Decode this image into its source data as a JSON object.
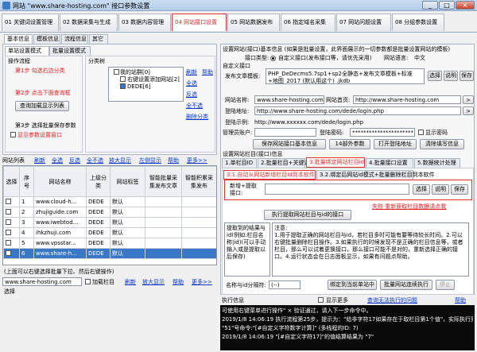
{
  "window": {
    "title": "网站 \"www.share-hosting.com\" 接口参数设置",
    "controls": [
      "_",
      "□",
      "×"
    ]
  },
  "maintabs": [
    "01 关键词设置管理",
    "02 数据采集与生成",
    "03 数据内容管理",
    "04 网站接口设置",
    "05 网站数据发布",
    "06 指定域名采集",
    "07 网站问题设置",
    "08 分组参数设置"
  ],
  "subtabs": [
    "基本信息",
    "模板信息",
    "流程信息",
    "其它"
  ],
  "left": {
    "mode_tabs": [
      "单站设置模式",
      "批量设置模式"
    ],
    "flow_title": "操作流程",
    "step1": "第1步 勾选右边分类",
    "step2": "第2步 点击下面查询框",
    "step2_btn": "查询加载显示列表",
    "step3": "第3步 选择批量保存参数",
    "show_params": "显示参数设置窗口",
    "cat_title": "分类树",
    "tree_root": "我的站群[0]",
    "tree_child1": "右键设置添加网站[2]",
    "tree_child2": "DEDE[6]",
    "cat_links": [
      "刷新",
      "帮助",
      "全选",
      "反选",
      "全不选",
      "删除分类"
    ]
  },
  "sitelist": {
    "label": "网站列表",
    "links": [
      "刷新",
      "全选",
      "反选",
      "全不选",
      "放大显示",
      "左侧显示",
      "帮助",
      "更多>>"
    ],
    "headers": [
      "选择",
      "序号",
      "网站名称",
      "上级分类",
      "网站标签",
      "智能批量采集发布文章",
      "智能积累采集发布"
    ],
    "rows": [
      {
        "no": "1",
        "name": "www.cloud-h...",
        "cat": "DEDE",
        "tag": "默认"
      },
      {
        "no": "2",
        "name": "zhujiguide.com",
        "cat": "DEDE",
        "tag": "默认"
      },
      {
        "no": "3",
        "name": "www.iwebtod...",
        "cat": "DEDE",
        "tag": "默认"
      },
      {
        "no": "4",
        "name": "ihkzhuji.com",
        "cat": "DEDE",
        "tag": "默认"
      },
      {
        "no": "5",
        "name": "www.vpsstar...",
        "cat": "DEDE",
        "tag": "默认"
      },
      {
        "no": "6",
        "name": "www.share-h...",
        "cat": "DEDE",
        "tag": "默认"
      }
    ],
    "hint": "(上面可以右键选择批量下拉、然后右键操作)",
    "current_site": "www.share-hosting.com",
    "add_category": "加载栏目",
    "foot_links": [
      "刷新",
      "放大显示",
      "帮助",
      "更多>>"
    ],
    "select_label": "选择"
  },
  "right": {
    "section_title": "设置网站(接口)基本信息 (如果是批量设置，此界面展示的一切参数都是批量设置网站的模板)",
    "iface_type_label": "接口类型:",
    "iface_custom": "自定义接口(发布接口等，请优先采用)",
    "site_lang_label": "网站语言:",
    "site_lang_value": "中文",
    "custom_iface_label": "自定义接口",
    "publish_tpl_label": "发布文章模板:",
    "publish_tpl_value": "PHP_DeDecms5.7sp1+sp2全静态+发布文章模板+标准+地图_2017 (默认用这个) .jkdb",
    "btn_select": "选择",
    "btn_explain": "说明",
    "btn_save": "保存",
    "site_addr_label": "网站名称:",
    "site_addr_value": "www.share-hosting.com",
    "homepage_label": "网站首页:",
    "homepage_value": "http://www.share-hosting.com",
    "login_addr_label": "登陆地址:",
    "login_addr_value": "http://www.share-hosting.com/dede/login.php",
    "login_example_label": "登陆示例:",
    "login_example_value": "http://www.xxxxxx.com/dede/login.php",
    "admin_label": "管理员账户:",
    "admin_value": "",
    "pwd_label": "登陆密码:",
    "pwd_value": "**********************",
    "show_pwd": "显示密码",
    "btn_save_basic": "保存网站接口基本信息",
    "btn_14": "14部外参数",
    "btn_open_login": "打开登陆地址",
    "btn_clear": "清除填写信息",
    "cat_info_title": "设置网站栏目(接口)信息",
    "cat_tabs": [
      "1.单栏目ID",
      "2.批量栏目+关键词",
      "3.批量绑定网站栏目id",
      "4.批量接口设置",
      "5.数据统计处理"
    ],
    "cat_subtabs": [
      "3.1.自动从网站新增栏目id到本软件",
      "3.2.绑定后网站id模式+批量删除栏目到本软件"
    ],
    "new_cat_label": "新增+提取接口:",
    "btn_select2": "选择",
    "btn_explain2": "说明",
    "btn_save2": "保存",
    "fail_link": "失败·重新获取栏目数据请点我",
    "btn_exec": "执行提取网站栏目与id的接口",
    "extract_label": "提取到的结果与id:",
    "note_title": "注意:",
    "note_body": "1.用于提取正确的网站栏目与id，若栏目多时可能有要等待较长时间。2.可以右键批量删除栏目操作。3.如果执行的时候发现不是正确的栏目信息等，或者栏目，那么可以试着更换接口，那么接口可能不是对的，重新选择正确的接口。4.运行状态会在日志面板显示，如果有问题点帮助。",
    "left_box_text": "提取到的结果与id(例如:栏目名称|id)(可以手动输入或是提取以后保存)",
    "bind_label": "名称与id分隔符:",
    "bind_value": "(--)",
    "btn_bind": "绑定到当前单站中",
    "btn_batch_bind": "批量网站连续执行",
    "btn_stop": "停止",
    "log_title": "执行信息",
    "log_show": "显示更多",
    "log_link": "查询无法执行的问题",
    "log_help": "帮助",
    "log_lines": [
      "可使用右键菜单进行操作\" × 验证通过，请入下一步命令中。",
      "2019/1/8 14:06:19  执行流程第25步，提示为：\"给非字符17如果存在于取栏目第1个值\"，实际执行第",
      "\"51\"号命令:\"[#自定义字符数字计算]\" (多线程的ID: 7)",
      "2019/1/8 14:06:19  \"[#自定义字符17]\"的值结算结果为 \"7\""
    ]
  }
}
